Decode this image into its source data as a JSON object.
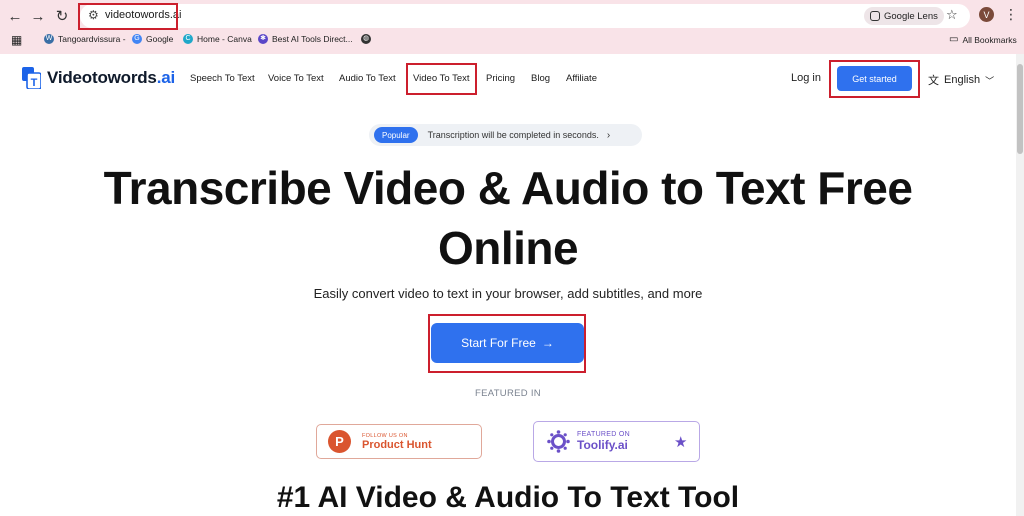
{
  "browser": {
    "url": "videotowords.ai",
    "lens_label": "Google Lens",
    "avatar_letter": "V",
    "bookmarks": [
      {
        "label": "Tangoardvissura -",
        "icon": "wordpress-icon",
        "color": "#3a6ea5"
      },
      {
        "label": "Google",
        "icon": "google-icon",
        "color": "#4285f4"
      },
      {
        "label": "Home - Canva",
        "icon": "canva-icon",
        "color": "#1fa8c9"
      },
      {
        "label": "Best AI Tools Direct...",
        "icon": "gear-icon",
        "color": "#5a46c8"
      },
      {
        "label": "",
        "icon": "globe-icon",
        "color": "#333333"
      }
    ],
    "all_bookmarks": "All Bookmarks"
  },
  "header": {
    "logo_main": "Videotowords",
    "logo_suffix": ".ai",
    "nav": [
      "Speech To Text",
      "Voice To Text",
      "Audio To Text",
      "Video To Text",
      "Pricing",
      "Blog",
      "Affiliate"
    ],
    "login": "Log in",
    "get_started": "Get started",
    "language": "English"
  },
  "hero": {
    "badge": "Popular",
    "announcement": "Transcription will be completed in seconds.",
    "title_line1": "Transcribe Video & Audio to Text Free",
    "title_line2": "Online",
    "subtitle": "Easily convert video to text in your browser, add subtitles, and more",
    "cta": "Start For Free"
  },
  "featured": {
    "label": "FEATURED IN",
    "product_hunt": {
      "small": "FOLLOW US ON",
      "big": "Product Hunt",
      "letter": "P"
    },
    "toolify": {
      "small": "FEATURED ON",
      "big": "Toolify.ai"
    }
  },
  "section": {
    "title": "#1 AI Video & Audio To Text Tool"
  },
  "colors": {
    "accent": "#2f71ee",
    "highlight": "#cc1f2d",
    "browser_chrome": "#f9e3e8"
  }
}
